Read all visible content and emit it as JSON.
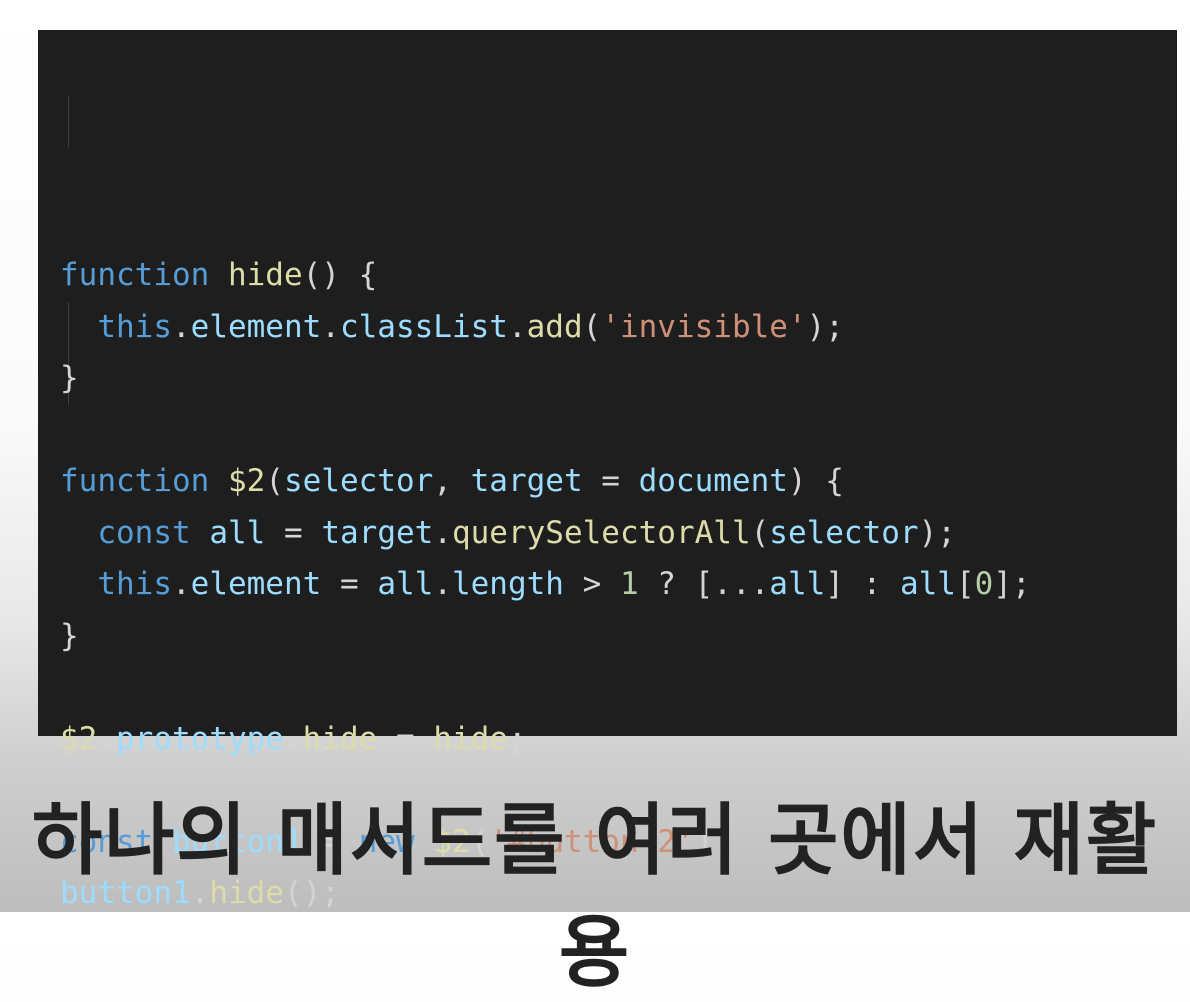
{
  "code": {
    "lines": [
      [
        {
          "t": "function",
          "c": "kw"
        },
        {
          "t": " ",
          "c": "punc"
        },
        {
          "t": "hide",
          "c": "fn"
        },
        {
          "t": "() {",
          "c": "punc"
        }
      ],
      [
        {
          "t": "  ",
          "c": "punc"
        },
        {
          "t": "this",
          "c": "kw"
        },
        {
          "t": ".",
          "c": "punc"
        },
        {
          "t": "element",
          "c": "var"
        },
        {
          "t": ".",
          "c": "punc"
        },
        {
          "t": "classList",
          "c": "var"
        },
        {
          "t": ".",
          "c": "punc"
        },
        {
          "t": "add",
          "c": "fn"
        },
        {
          "t": "(",
          "c": "punc"
        },
        {
          "t": "'invisible'",
          "c": "str"
        },
        {
          "t": ");",
          "c": "punc"
        }
      ],
      [
        {
          "t": "}",
          "c": "punc"
        }
      ],
      [],
      [
        {
          "t": "function",
          "c": "kw"
        },
        {
          "t": " ",
          "c": "punc"
        },
        {
          "t": "$2",
          "c": "fn"
        },
        {
          "t": "(",
          "c": "punc"
        },
        {
          "t": "selector",
          "c": "var"
        },
        {
          "t": ", ",
          "c": "punc"
        },
        {
          "t": "target",
          "c": "var"
        },
        {
          "t": " = ",
          "c": "punc"
        },
        {
          "t": "document",
          "c": "var"
        },
        {
          "t": ") {",
          "c": "punc"
        }
      ],
      [
        {
          "t": "  ",
          "c": "punc"
        },
        {
          "t": "const",
          "c": "kw"
        },
        {
          "t": " ",
          "c": "punc"
        },
        {
          "t": "all",
          "c": "var"
        },
        {
          "t": " = ",
          "c": "punc"
        },
        {
          "t": "target",
          "c": "var"
        },
        {
          "t": ".",
          "c": "punc"
        },
        {
          "t": "querySelectorAll",
          "c": "fn"
        },
        {
          "t": "(",
          "c": "punc"
        },
        {
          "t": "selector",
          "c": "var"
        },
        {
          "t": ");",
          "c": "punc"
        }
      ],
      [
        {
          "t": "  ",
          "c": "punc"
        },
        {
          "t": "this",
          "c": "kw"
        },
        {
          "t": ".",
          "c": "punc"
        },
        {
          "t": "element",
          "c": "var"
        },
        {
          "t": " = ",
          "c": "punc"
        },
        {
          "t": "all",
          "c": "var"
        },
        {
          "t": ".",
          "c": "punc"
        },
        {
          "t": "length",
          "c": "var"
        },
        {
          "t": " > ",
          "c": "punc"
        },
        {
          "t": "1",
          "c": "num"
        },
        {
          "t": " ? [...",
          "c": "punc"
        },
        {
          "t": "all",
          "c": "var"
        },
        {
          "t": "] : ",
          "c": "punc"
        },
        {
          "t": "all",
          "c": "var"
        },
        {
          "t": "[",
          "c": "punc"
        },
        {
          "t": "0",
          "c": "num"
        },
        {
          "t": "];",
          "c": "punc"
        }
      ],
      [
        {
          "t": "}",
          "c": "punc"
        }
      ],
      [],
      [
        {
          "t": "$2",
          "c": "fn"
        },
        {
          "t": ".",
          "c": "punc"
        },
        {
          "t": "prototype",
          "c": "var"
        },
        {
          "t": ".",
          "c": "punc"
        },
        {
          "t": "hide",
          "c": "fn"
        },
        {
          "t": " = ",
          "c": "punc"
        },
        {
          "t": "hide",
          "c": "fn"
        },
        {
          "t": ";",
          "c": "punc"
        }
      ],
      [],
      [
        {
          "t": "const",
          "c": "kw"
        },
        {
          "t": " ",
          "c": "punc"
        },
        {
          "t": "button1",
          "c": "var"
        },
        {
          "t": " = ",
          "c": "punc"
        },
        {
          "t": "new",
          "c": "kw"
        },
        {
          "t": " ",
          "c": "punc"
        },
        {
          "t": "$2",
          "c": "fn"
        },
        {
          "t": "(",
          "c": "punc"
        },
        {
          "t": "'#button-2'",
          "c": "str"
        },
        {
          "t": ");",
          "c": "punc"
        }
      ],
      [
        {
          "t": "button1",
          "c": "var"
        },
        {
          "t": ".",
          "c": "punc"
        },
        {
          "t": "hide",
          "c": "fn"
        },
        {
          "t": "();",
          "c": "punc"
        }
      ]
    ]
  },
  "caption": "하나의 매서드를 여러 곳에서 재활용",
  "colors": {
    "editor_background": "#1e1e1e",
    "keyword": "#569cd6",
    "function": "#dcdcaa",
    "variable": "#9cdcfe",
    "string": "#ce9178",
    "number": "#b5cea8",
    "punctuation": "#d4d4d4",
    "caption": "#222222"
  }
}
